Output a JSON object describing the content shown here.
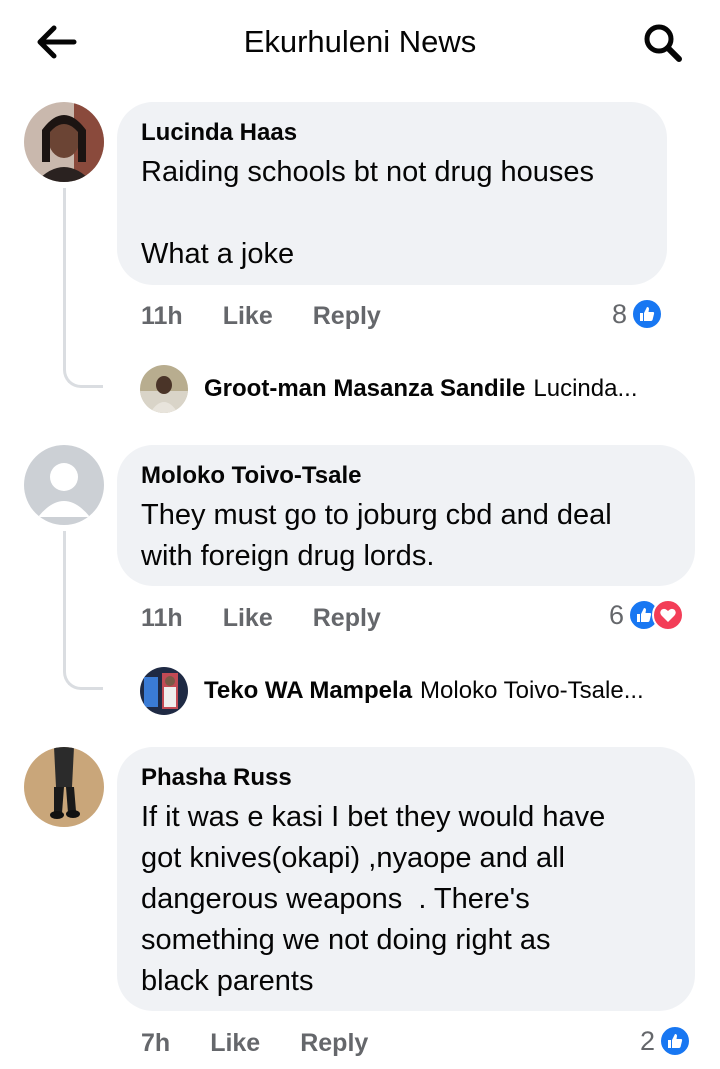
{
  "header": {
    "title": "Ekurhuleni News",
    "back_icon": "arrow-left-icon",
    "search_icon": "search-icon"
  },
  "colors": {
    "bubble_bg": "#f0f2f5",
    "like_blue": "#1877f2",
    "love_red": "#f33e58",
    "meta_gray": "#65676b"
  },
  "comments": [
    {
      "author": "Lucinda Haas",
      "text": "Raiding schools bt not drug houses\n\nWhat a joke",
      "time": "11h",
      "like_label": "Like",
      "reply_label": "Reply",
      "reaction_count": "8",
      "reactions": [
        "like"
      ],
      "reply": {
        "author": "Groot-man Masanza Sandile",
        "snippet": "Lucinda..."
      }
    },
    {
      "author": "Moloko Toivo-Tsale",
      "text": "They must go to joburg cbd and deal\nwith foreign drug lords.",
      "time": "11h",
      "like_label": "Like",
      "reply_label": "Reply",
      "reaction_count": "6",
      "reactions": [
        "like",
        "love"
      ],
      "reply": {
        "author": "Teko WA Mampela",
        "snippet": "Moloko Toivo-Tsale..."
      }
    },
    {
      "author": "Phasha Russ",
      "text": "If it was e kasi I bet they would have\ngot knives(okapi) ,nyaope and all\ndangerous weapons  . There's\nsomething we not doing right as\nblack parents",
      "time": "7h",
      "like_label": "Like",
      "reply_label": "Reply",
      "reaction_count": "2",
      "reactions": [
        "like"
      ]
    }
  ]
}
